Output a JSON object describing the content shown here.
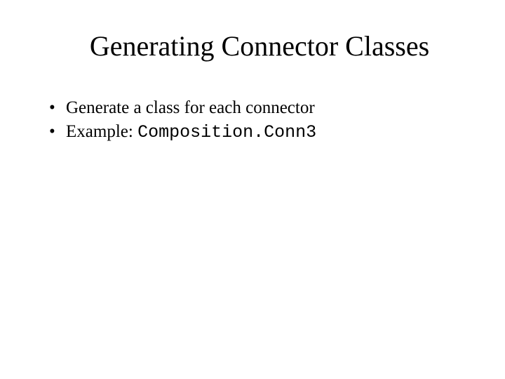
{
  "slide": {
    "title": "Generating Connector Classes",
    "bullets": [
      {
        "text": "Generate a class for each connector"
      },
      {
        "prefix": "Example: ",
        "code": "Composition.Conn3"
      }
    ]
  }
}
